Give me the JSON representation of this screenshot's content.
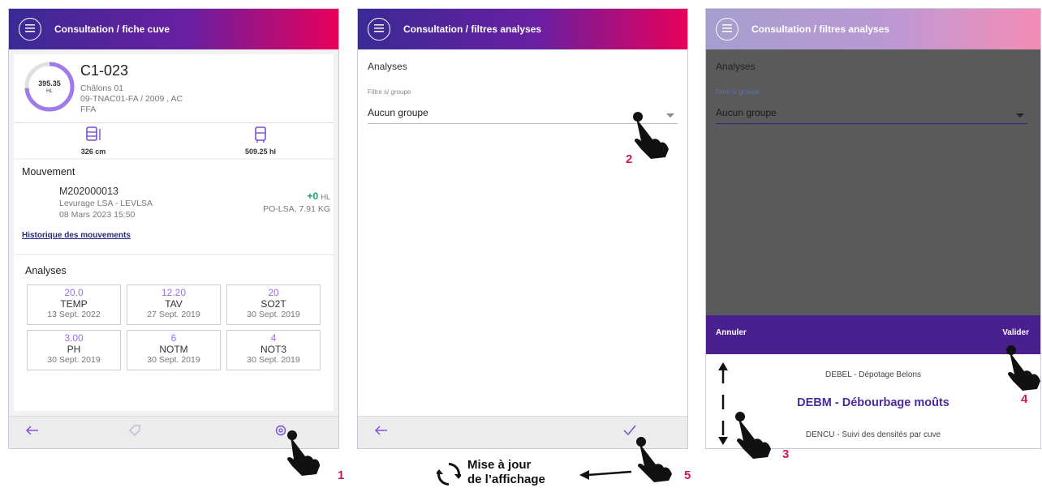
{
  "panel1": {
    "title": "Consultation / fiche cuve",
    "tank_volume": "395.35",
    "tank_unit": "HL",
    "tank_id": "C1-023",
    "site": "Châlons 01",
    "ref": "09-TNAC01-FA / 2009 , AC",
    "code": "FFA",
    "stat_left": "326 cm",
    "stat_right": "509.25 hl",
    "movement_header": "Mouvement",
    "movement_id": "M202000013",
    "movement_desc": "Levurage LSA - LEVLSA",
    "movement_date": "08 Mars 2023 15:50",
    "movement_amount": "+0",
    "movement_unit": "HL",
    "movement_extra": "PO-LSA, 7.91 KG",
    "history_link": "Historique des mouvements",
    "analyses_header": "Analyses",
    "analyses": [
      {
        "value": "20.0",
        "code": "TEMP",
        "date": "13 Sept. 2022"
      },
      {
        "value": "12.20",
        "code": "TAV",
        "date": "27 Sept. 2019"
      },
      {
        "value": "20",
        "code": "SO2T",
        "date": "30 Sept. 2019"
      },
      {
        "value": "3.00",
        "code": "PH",
        "date": "30 Sept. 2019"
      },
      {
        "value": "6",
        "code": "NOTM",
        "date": "30 Sept. 2019"
      },
      {
        "value": "4",
        "code": "NOT3",
        "date": "30 Sept. 2019"
      }
    ]
  },
  "panel2": {
    "title": "Consultation / filtres analyses",
    "section": "Analyses",
    "filter_label": "Filtre s/ groupe",
    "filter_value": "Aucun groupe"
  },
  "panel3": {
    "title": "Consultation / filtres analyses",
    "section": "Analyses",
    "filter_label": "Filtre s/ groupe",
    "filter_value": "Aucun groupe",
    "cancel": "Annuler",
    "validate": "Valider",
    "options": [
      "DEBEL - Dépotage Belons",
      "DEBM - Débourbage moûts",
      "DENCU - Suivi des densités par cuve"
    ]
  },
  "annotations": {
    "step1": "1",
    "step2": "2",
    "step3": "3",
    "step4": "4",
    "step5": "5",
    "refresh_line1": "Mise à jour",
    "refresh_line2": "de l’affichage"
  },
  "colors": {
    "accent": "#9b6dea",
    "purple_bar": "#4a1f8f",
    "step": "#d4145a",
    "green": "#1aa361"
  }
}
